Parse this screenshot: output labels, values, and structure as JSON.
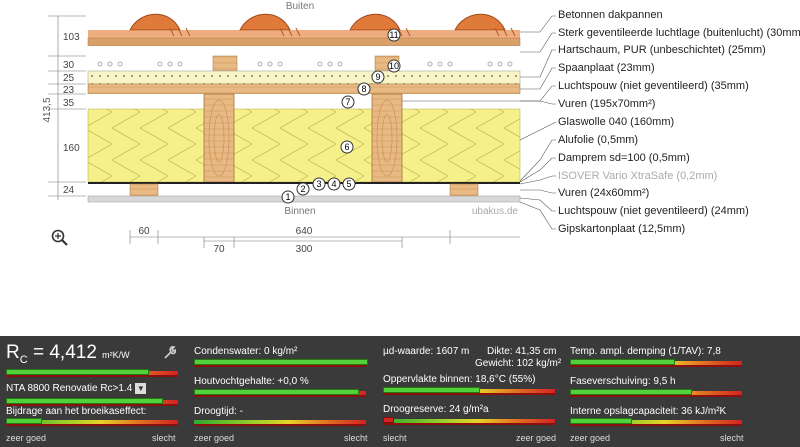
{
  "outside_label": "Buiten",
  "inside_label": "Binnen",
  "watermark": "ubakus.de",
  "total_dim": "413,5",
  "left_dims": [
    "103",
    "30",
    "25",
    "23",
    "35",
    "160",
    "24"
  ],
  "markers": [
    "1",
    "2",
    "3",
    "4",
    "5",
    "6",
    "7",
    "8",
    "9",
    "10",
    "11"
  ],
  "layers": [
    "Betonnen dakpannen",
    "Sterk geventileerde luchtlage (buitenlucht) (30mm)",
    "Hartschaum, PUR (unbeschichtet) (25mm)",
    "Spaanplaat (23mm)",
    "Luchtspouw (niet geventileerd) (35mm)",
    "Vuren (195x70mm²)",
    "Glaswolle 040 (160mm)",
    "Alufolie (0,5mm)",
    "Dampremsd=100 (0,5mm)",
    "ISOVER Vario XtraSafe (0,2mm)",
    "Vuren (24x60mm²)",
    "Luchtspouw (niet geventileerd) (24mm)",
    "Gipskartonplaat (12,5mm)"
  ],
  "bottom_dims": {
    "d60": "60",
    "d640": "640",
    "d70": "70",
    "d300": "300"
  },
  "colors": {
    "panel_bg": "#3a3a3a",
    "good": "#53d13b",
    "tile": "#e07a3a",
    "insulation": "#f5f08a",
    "wood": "#e2b07a"
  },
  "zoom_icon": "zoom-in-icon",
  "rc": {
    "label_main": "R",
    "label_sub": "C",
    "value": "= 4,412",
    "unit": "m²K/W",
    "progress": 0.82
  },
  "wrench_icon": "wrench-icon",
  "norm": {
    "label": "NTA 8800 Renovatie Rc>1.4",
    "progress": 0.9
  },
  "greenhouse": {
    "label": "Bijdrage aan het broeikaseffect:",
    "progress": 0.2
  },
  "scale_good": "zeer goed",
  "scale_bad": "slecht",
  "condensation": {
    "label": "Condenswater: 0 kg/m²",
    "progress": 1.0
  },
  "wood_moisture": {
    "label": "Houtvochtgehalte: +0,0 %",
    "progress": 0.95
  },
  "drying_time": {
    "label": "Droogtijd: -",
    "progress": 0.0
  },
  "sd_value": {
    "label": "µd-waarde: 1607 m",
    "progress": 0.0
  },
  "thickness": {
    "label": "Dikte: 41,35 cm"
  },
  "weight": {
    "label": "Gewicht: 102 kg/m²"
  },
  "surface_temp": {
    "label": "Oppervlakte binnen: 18,6°C (55%)",
    "progress": 0.55
  },
  "drying_reserve": {
    "label": "Droogreserve: 24 g/m²a",
    "progress": 0.05
  },
  "temp_amp": {
    "label": "Temp. ampl. demping (1/TAV): 7,8",
    "progress": 0.6
  },
  "phase_shift": {
    "label": "Faseverschuiving: 9,5 h",
    "progress": 0.7
  },
  "heat_capacity": {
    "label": "Interne opslagcapaciteit: 36 kJ/m²K",
    "progress": 0.35
  }
}
